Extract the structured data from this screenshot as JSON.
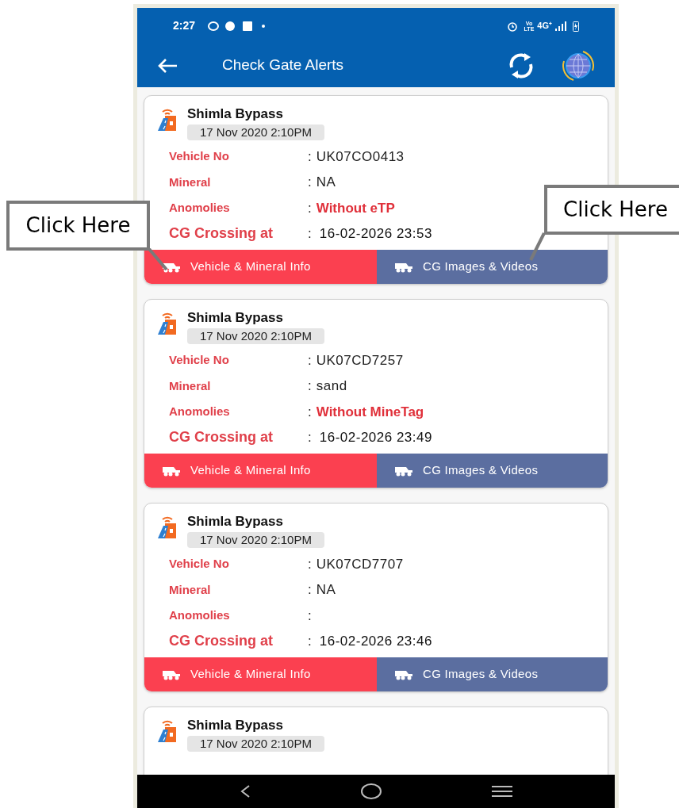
{
  "status_bar": {
    "time": "2:27",
    "volte_top": "Vo",
    "volte_bottom": "LTE",
    "network": "4G⁺"
  },
  "app_bar": {
    "title": "Check Gate Alerts"
  },
  "cards": [
    {
      "title": "Shimla Bypass",
      "date": "17 Nov 2020 2:10PM",
      "rows": [
        {
          "kind": "plain",
          "label": "Vehicle No",
          "separator": ":",
          "value": "UK07CO0413"
        },
        {
          "kind": "plain",
          "label": "Mineral",
          "separator": ":",
          "value": "NA"
        },
        {
          "kind": "alert",
          "label": "Anomolies",
          "separator": ":",
          "value": "Without eTP"
        },
        {
          "kind": "crossing",
          "label": "CG Crossing at",
          "separator": ":",
          "value": "16-02-2026 23:53"
        }
      ],
      "buttons": [
        {
          "kind": "primary",
          "label": "Vehicle & Mineral Info"
        },
        {
          "kind": "secondary",
          "label": "CG Images & Videos"
        }
      ]
    },
    {
      "title": "Shimla Bypass",
      "date": "17 Nov 2020 2:10PM",
      "rows": [
        {
          "kind": "plain",
          "label": "Vehicle No",
          "separator": ":",
          "value": "UK07CD7257"
        },
        {
          "kind": "plain",
          "label": "Mineral",
          "separator": ":",
          "value": "sand"
        },
        {
          "kind": "alert",
          "label": "Anomolies",
          "separator": ":",
          "value": "Without MineTag"
        },
        {
          "kind": "crossing",
          "label": "CG Crossing at",
          "separator": ":",
          "value": "16-02-2026 23:49"
        }
      ],
      "buttons": [
        {
          "kind": "primary",
          "label": "Vehicle & Mineral Info"
        },
        {
          "kind": "secondary",
          "label": "CG Images & Videos"
        }
      ]
    },
    {
      "title": "Shimla Bypass",
      "date": "17 Nov 2020 2:10PM",
      "rows": [
        {
          "kind": "plain",
          "label": "Vehicle No",
          "separator": ":",
          "value": "UK07CD7707"
        },
        {
          "kind": "plain",
          "label": "Mineral",
          "separator": ":",
          "value": "NA"
        },
        {
          "kind": "alert",
          "label": "Anomolies",
          "separator": ":"
        },
        {
          "kind": "crossing",
          "label": "CG Crossing at",
          "separator": ":",
          "value": "16-02-2026 23:46"
        }
      ],
      "buttons": [
        {
          "kind": "primary",
          "label": "Vehicle & Mineral Info"
        },
        {
          "kind": "secondary",
          "label": "CG Images & Videos"
        }
      ]
    },
    {
      "title": "Shimla Bypass",
      "date": "17 Nov 2020 2:10PM"
    }
  ],
  "callouts": [
    {
      "text": "Click Here"
    },
    {
      "text": "Click Here"
    }
  ]
}
